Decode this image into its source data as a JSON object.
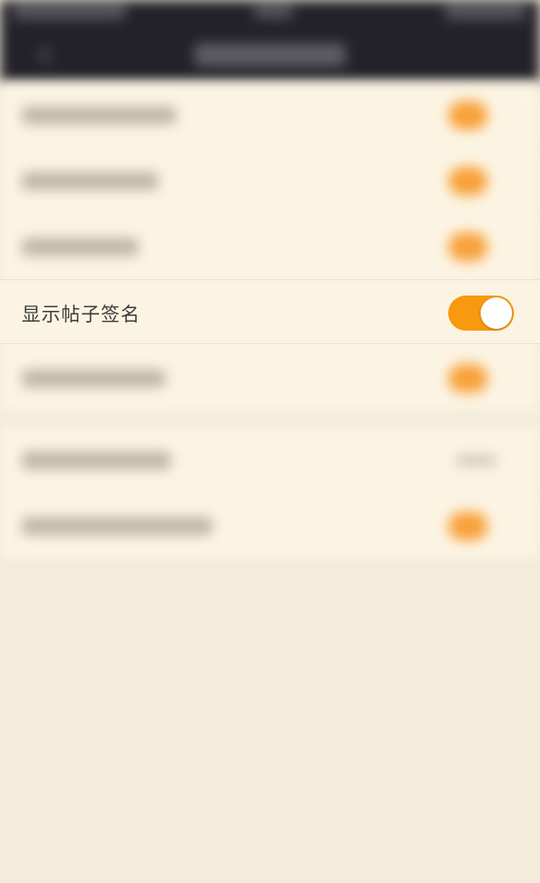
{
  "settings": {
    "focused_item": {
      "label": "显示帖子签名",
      "toggle_on": true
    }
  },
  "colors": {
    "accent": "#f8990f",
    "background": "#f3ecdb",
    "list_background": "#fcf4e3",
    "header_background": "#23222a"
  }
}
